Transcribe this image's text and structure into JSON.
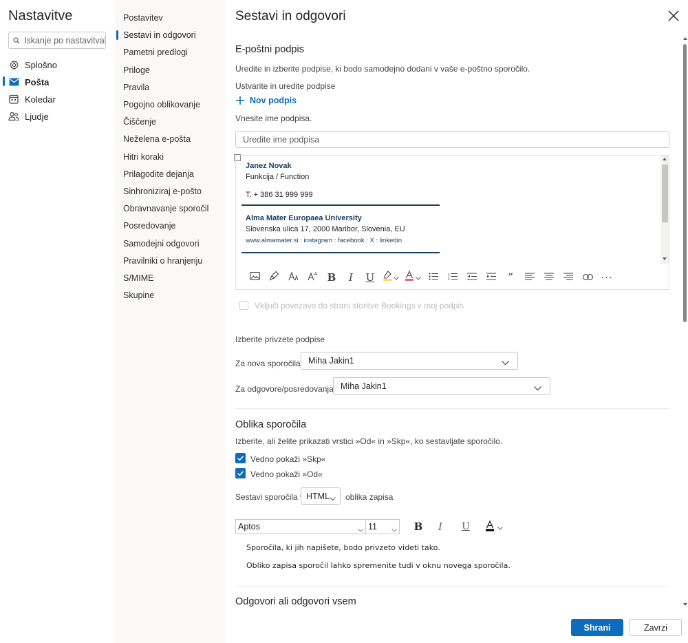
{
  "app": {
    "title": "Nastavitve",
    "search_placeholder": "Iskanje po nastavitval"
  },
  "categories": [
    {
      "label": "Splošno",
      "icon": "gear-icon"
    },
    {
      "label": "Pošta",
      "icon": "mail-icon",
      "active": true
    },
    {
      "label": "Koledar",
      "icon": "calendar-icon"
    },
    {
      "label": "Ljudje",
      "icon": "people-icon"
    }
  ],
  "subnav": [
    "Postavitev",
    "Sestavi in odgovori",
    "Pametni predlogi",
    "Priloge",
    "Pravila",
    "Pogojno oblikovanje",
    "Čiščenje",
    "Neželena e-pošta",
    "Hitri koraki",
    "Prilagodite dejanja",
    "Sinhroniziraj e-pošto",
    "Obravnavanje sporočil",
    "Posredovanje",
    "Samodejni odgovori",
    "Pravilniki o hranjenju",
    "S/MIME",
    "Skupine"
  ],
  "panel": {
    "title": "Sestavi in odgovori"
  },
  "signature": {
    "heading": "E-poštni podpis",
    "description": "Uredite in izberite podpise, ki bodo samodejno dodani v vaše e-poštno sporočilo.",
    "create_label": "Ustvarite in uredite podpise",
    "new_signature": "Nov podpis",
    "name_label": "Vnesite ime podpisa.",
    "name_placeholder": "Uredite ime podpisa",
    "content": {
      "name": "Janez Novak",
      "function": "Funkcija / Function",
      "phone": "T: + 386 31 999 999",
      "org": "Alma Mater Europaea University",
      "address": "Slovenska ulica 17, 2000 Maribor, Slovenia, EU",
      "links": "www.almamater.si : instagram : facebook : X : linkedin"
    },
    "bookings_label": "Vključi povezavo do strani storitve Bookings v moj podpis",
    "defaults_heading": "Izberite privzete podpise",
    "new_messages_label": "Za nova sporočila:",
    "new_messages_value": "Miha Jakin1",
    "replies_label": "Za odgovore/posredovanja:",
    "replies_value": "Miha Jakin1"
  },
  "format": {
    "heading": "Oblika sporočila",
    "description": "Izberite, ali želite prikazati vrstici »Od« in »Skp«, ko sestavljate sporočilo.",
    "show_bcc": "Vedno pokaži »Skp«",
    "show_from": "Vedno pokaži »Od«",
    "compose_label": "Sestavi sporočila v",
    "compose_value": "HTML",
    "compose_suffix": "oblika zapisa",
    "font": "Aptos",
    "size": "11",
    "preview_1": "Sporočila, ki jih napišete, bodo privzeto videti tako.",
    "preview_2": "Obliko zapisa sporočil lahko spremenite tudi v oknu novega sporočila."
  },
  "reply": {
    "heading": "Odgovori ali odgovori vsem"
  },
  "footer": {
    "save": "Shrani",
    "discard": "Zavrzi"
  },
  "colors": {
    "accent": "#0f6cbd",
    "signature_name": "#1b3e63",
    "highlight": "#ffd600",
    "font_color": "#d13438"
  }
}
